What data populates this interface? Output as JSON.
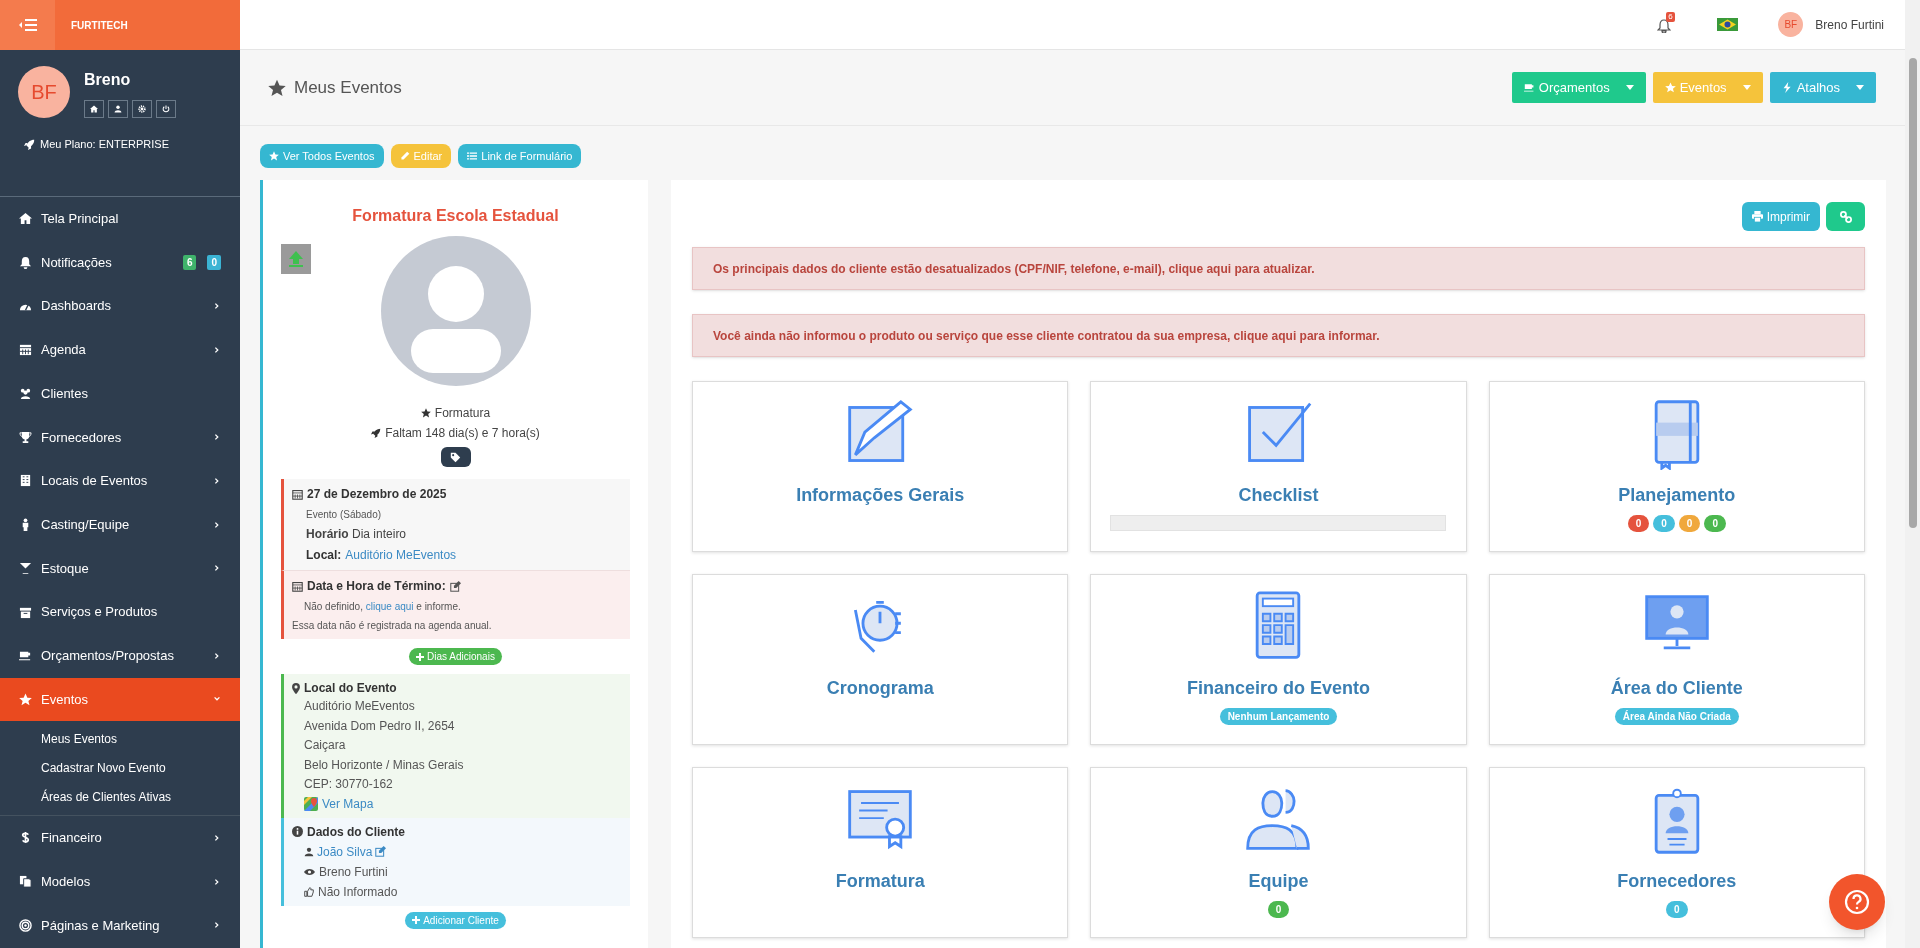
{
  "brand": "FURTITECH",
  "profile": {
    "initials": "BF",
    "name": "Breno",
    "plan": "Meu Plano: ENTERPRISE"
  },
  "sidebar": {
    "items": [
      {
        "label": "Tela Principal",
        "arrow": false,
        "selected": false
      },
      {
        "label": "Notificações",
        "arrow": false,
        "selected": false,
        "badges": [
          {
            "text": "6",
            "color": "#3fb36b"
          },
          {
            "text": "0",
            "color": "#3bb4d4"
          }
        ]
      },
      {
        "label": "Dashboards",
        "arrow": true,
        "selected": false
      },
      {
        "label": "Agenda",
        "arrow": true,
        "selected": false
      },
      {
        "label": "Clientes",
        "arrow": false,
        "selected": false
      },
      {
        "label": "Fornecedores",
        "arrow": true,
        "selected": false
      },
      {
        "label": "Locais de Eventos",
        "arrow": true,
        "selected": false
      },
      {
        "label": "Casting/Equipe",
        "arrow": true,
        "selected": false
      },
      {
        "label": "Estoque",
        "arrow": true,
        "selected": false
      },
      {
        "label": "Serviços e Produtos",
        "arrow": false,
        "selected": false
      },
      {
        "label": "Orçamentos/Propostas",
        "arrow": true,
        "selected": false
      },
      {
        "label": "Eventos",
        "arrow": true,
        "selected": true,
        "expanded": true,
        "children": [
          {
            "label": "Meus Eventos"
          },
          {
            "label": "Cadastrar Novo Evento"
          },
          {
            "label": "Áreas de Clientes Ativas"
          }
        ]
      },
      {
        "label": "Financeiro",
        "arrow": true,
        "selected": false
      },
      {
        "label": "Modelos",
        "arrow": true,
        "selected": false
      },
      {
        "label": "Páginas e Marketing",
        "arrow": true,
        "selected": false
      }
    ]
  },
  "header": {
    "notification_count": "6",
    "user_initials": "BF",
    "user_name": "Breno Furtini"
  },
  "page_title": "Meus Eventos",
  "top_buttons": [
    {
      "label": "Orçamentos",
      "color": "#1fc98c"
    },
    {
      "label": "Eventos",
      "color": "#f5c33b"
    },
    {
      "label": "Atalhos",
      "color": "#35b7d1"
    }
  ],
  "action_buttons": [
    {
      "label": "Ver Todos Eventos",
      "color": "#35b7d1"
    },
    {
      "label": "Editar",
      "color": "#f5c33b"
    },
    {
      "label": "Link de Formulário",
      "color": "#35b7d1"
    }
  ],
  "event": {
    "title": "Formatura Escola Estadual",
    "type": "Formatura",
    "countdown": "Faltam 148 dia(s) e 7 hora(s)",
    "date": "27 de Dezembro de 2025",
    "weekday": "Evento (Sábado)",
    "time_label": "Horário",
    "time": "Dia inteiro",
    "place_label": "Local:",
    "place": "Auditório MeEventos",
    "end_title": "Data e Hora de Término:",
    "end_text_before": "Não definido,",
    "end_link": "clique aqui",
    "end_text_after": "e informe.",
    "end_note": "Essa data não é registrada na agenda anual.",
    "extra_days_button": "Dias Adicionais",
    "venue_title": "Local do Evento",
    "venue_lines": [
      "Auditório MeEventos",
      "Avenida Dom Pedro II, 2654",
      "Caiçara",
      "Belo Horizonte / Minas Gerais",
      "CEP: 30770-162"
    ],
    "map_link": "Ver Mapa",
    "client_title": "Dados do Cliente",
    "client_name": "João Silva",
    "client_owner": "Breno Furtini",
    "client_feedback": "Não Informado",
    "add_client_button": "Adicionar Cliente"
  },
  "panel_buttons": {
    "print": "Imprimir"
  },
  "alerts": [
    "Os principais dados do cliente estão desatualizados (CPF/NIF, telefone, e-mail), clique aqui para atualizar.",
    "Você ainda não informou o produto ou serviço que esse cliente contratou da sua empresa, clique aqui para informar."
  ],
  "tiles": [
    {
      "title": "Informações Gerais"
    },
    {
      "title": "Checklist",
      "level": 0
    },
    {
      "title": "Planejamento",
      "badges": [
        {
          "text": "0",
          "color": "#e5533d"
        },
        {
          "text": "0",
          "color": "#45bfdc"
        },
        {
          "text": "0",
          "color": "#f0a83c"
        },
        {
          "text": "0",
          "color": "#4cb84f"
        }
      ]
    },
    {
      "title": "Cronograma"
    },
    {
      "title": "Financeiro do Evento",
      "badges": [
        {
          "text": "Nenhum Lançamento",
          "color": "#45bfdc"
        }
      ]
    },
    {
      "title": "Área do Cliente",
      "badges": [
        {
          "text": "Área Ainda Não Criada",
          "color": "#45bfdc"
        }
      ]
    },
    {
      "title": "Formatura"
    },
    {
      "title": "Equipe",
      "badges": [
        {
          "text": "0",
          "color": "#4cb84f"
        }
      ]
    },
    {
      "title": "Fornecedores",
      "badges": [
        {
          "text": "0",
          "color": "#45bfdc"
        }
      ]
    }
  ]
}
